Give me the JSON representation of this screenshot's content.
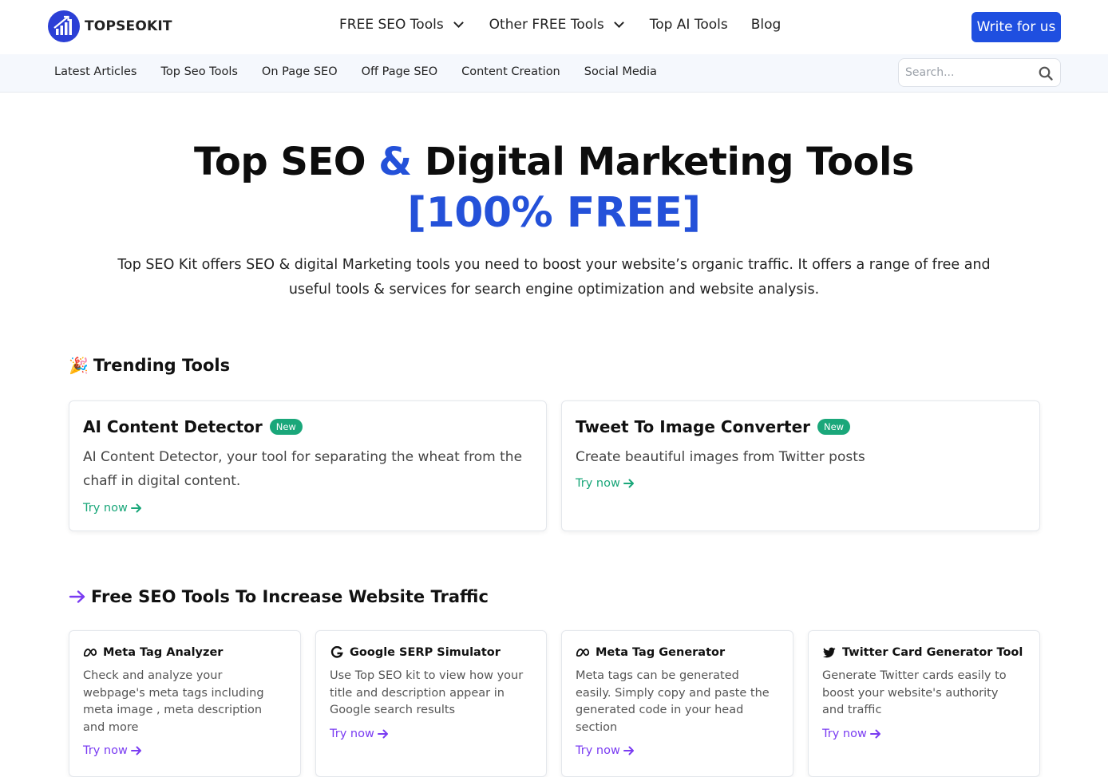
{
  "brand": {
    "name": "TOPSEOKIT",
    "logo_icon": "bar-chart-circle-icon",
    "accent": "#2451d9"
  },
  "header": {
    "nav": [
      {
        "label": "FREE SEO Tools",
        "dropdown": true
      },
      {
        "label": "Other FREE Tools",
        "dropdown": true
      },
      {
        "label": "Top AI Tools",
        "dropdown": false
      },
      {
        "label": "Blog",
        "dropdown": false
      }
    ],
    "cta": "Write for us"
  },
  "subnav": {
    "items": [
      "Latest Articles",
      "Top Seo Tools",
      "On Page SEO",
      "Off Page SEO",
      "Content Creation",
      "Social Media"
    ],
    "search_placeholder": "Search..."
  },
  "hero": {
    "title_part1": "Top SEO ",
    "title_amp": "&",
    "title_part2": " Digital Marketing Tools",
    "title_free": "[100% FREE]",
    "description": "Top SEO Kit offers SEO & digital Marketing tools you need to boost your website’s organic traffic. It offers a range of free and useful tools & services for search engine optimization and website analysis."
  },
  "trending": {
    "emoji": "🎉",
    "heading": "Trending Tools",
    "cards": [
      {
        "title": "AI Content Detector",
        "badge": "New",
        "description": "AI Content Detector, your tool for separating the wheat from the chaff in digital content.",
        "link": "Try now"
      },
      {
        "title": "Tweet To Image Converter",
        "badge": "New",
        "description": "Create beautiful images from Twitter posts",
        "link": "Try now"
      }
    ]
  },
  "seo_tools": {
    "heading": "Free SEO Tools To Increase Website Traffic",
    "heading_icon": "arrow-right-icon",
    "cards": [
      {
        "icon": "meta-logo-icon",
        "title": "Meta Tag Analyzer",
        "description": "Check and analyze your webpage's meta tags including meta image , meta description and more",
        "link": "Try now"
      },
      {
        "icon": "google-logo-icon",
        "title": "Google SERP Simulator",
        "description": "Use Top SEO kit to view how your title and description appear in Google search results",
        "link": "Try now"
      },
      {
        "icon": "meta-logo-icon",
        "title": "Meta Tag Generator",
        "description": "Meta tags can be generated easily. Simply copy and paste the generated code in your head section",
        "link": "Try now"
      },
      {
        "icon": "twitter-bird-icon",
        "title": "Twitter Card Generator Tool",
        "description": "Generate Twitter cards easily to boost your website's authority and traffic",
        "link": "Try now"
      }
    ]
  },
  "colors": {
    "cta": "#1f4fe0",
    "green": "#1aa77a",
    "purple": "#7a3cf2"
  }
}
